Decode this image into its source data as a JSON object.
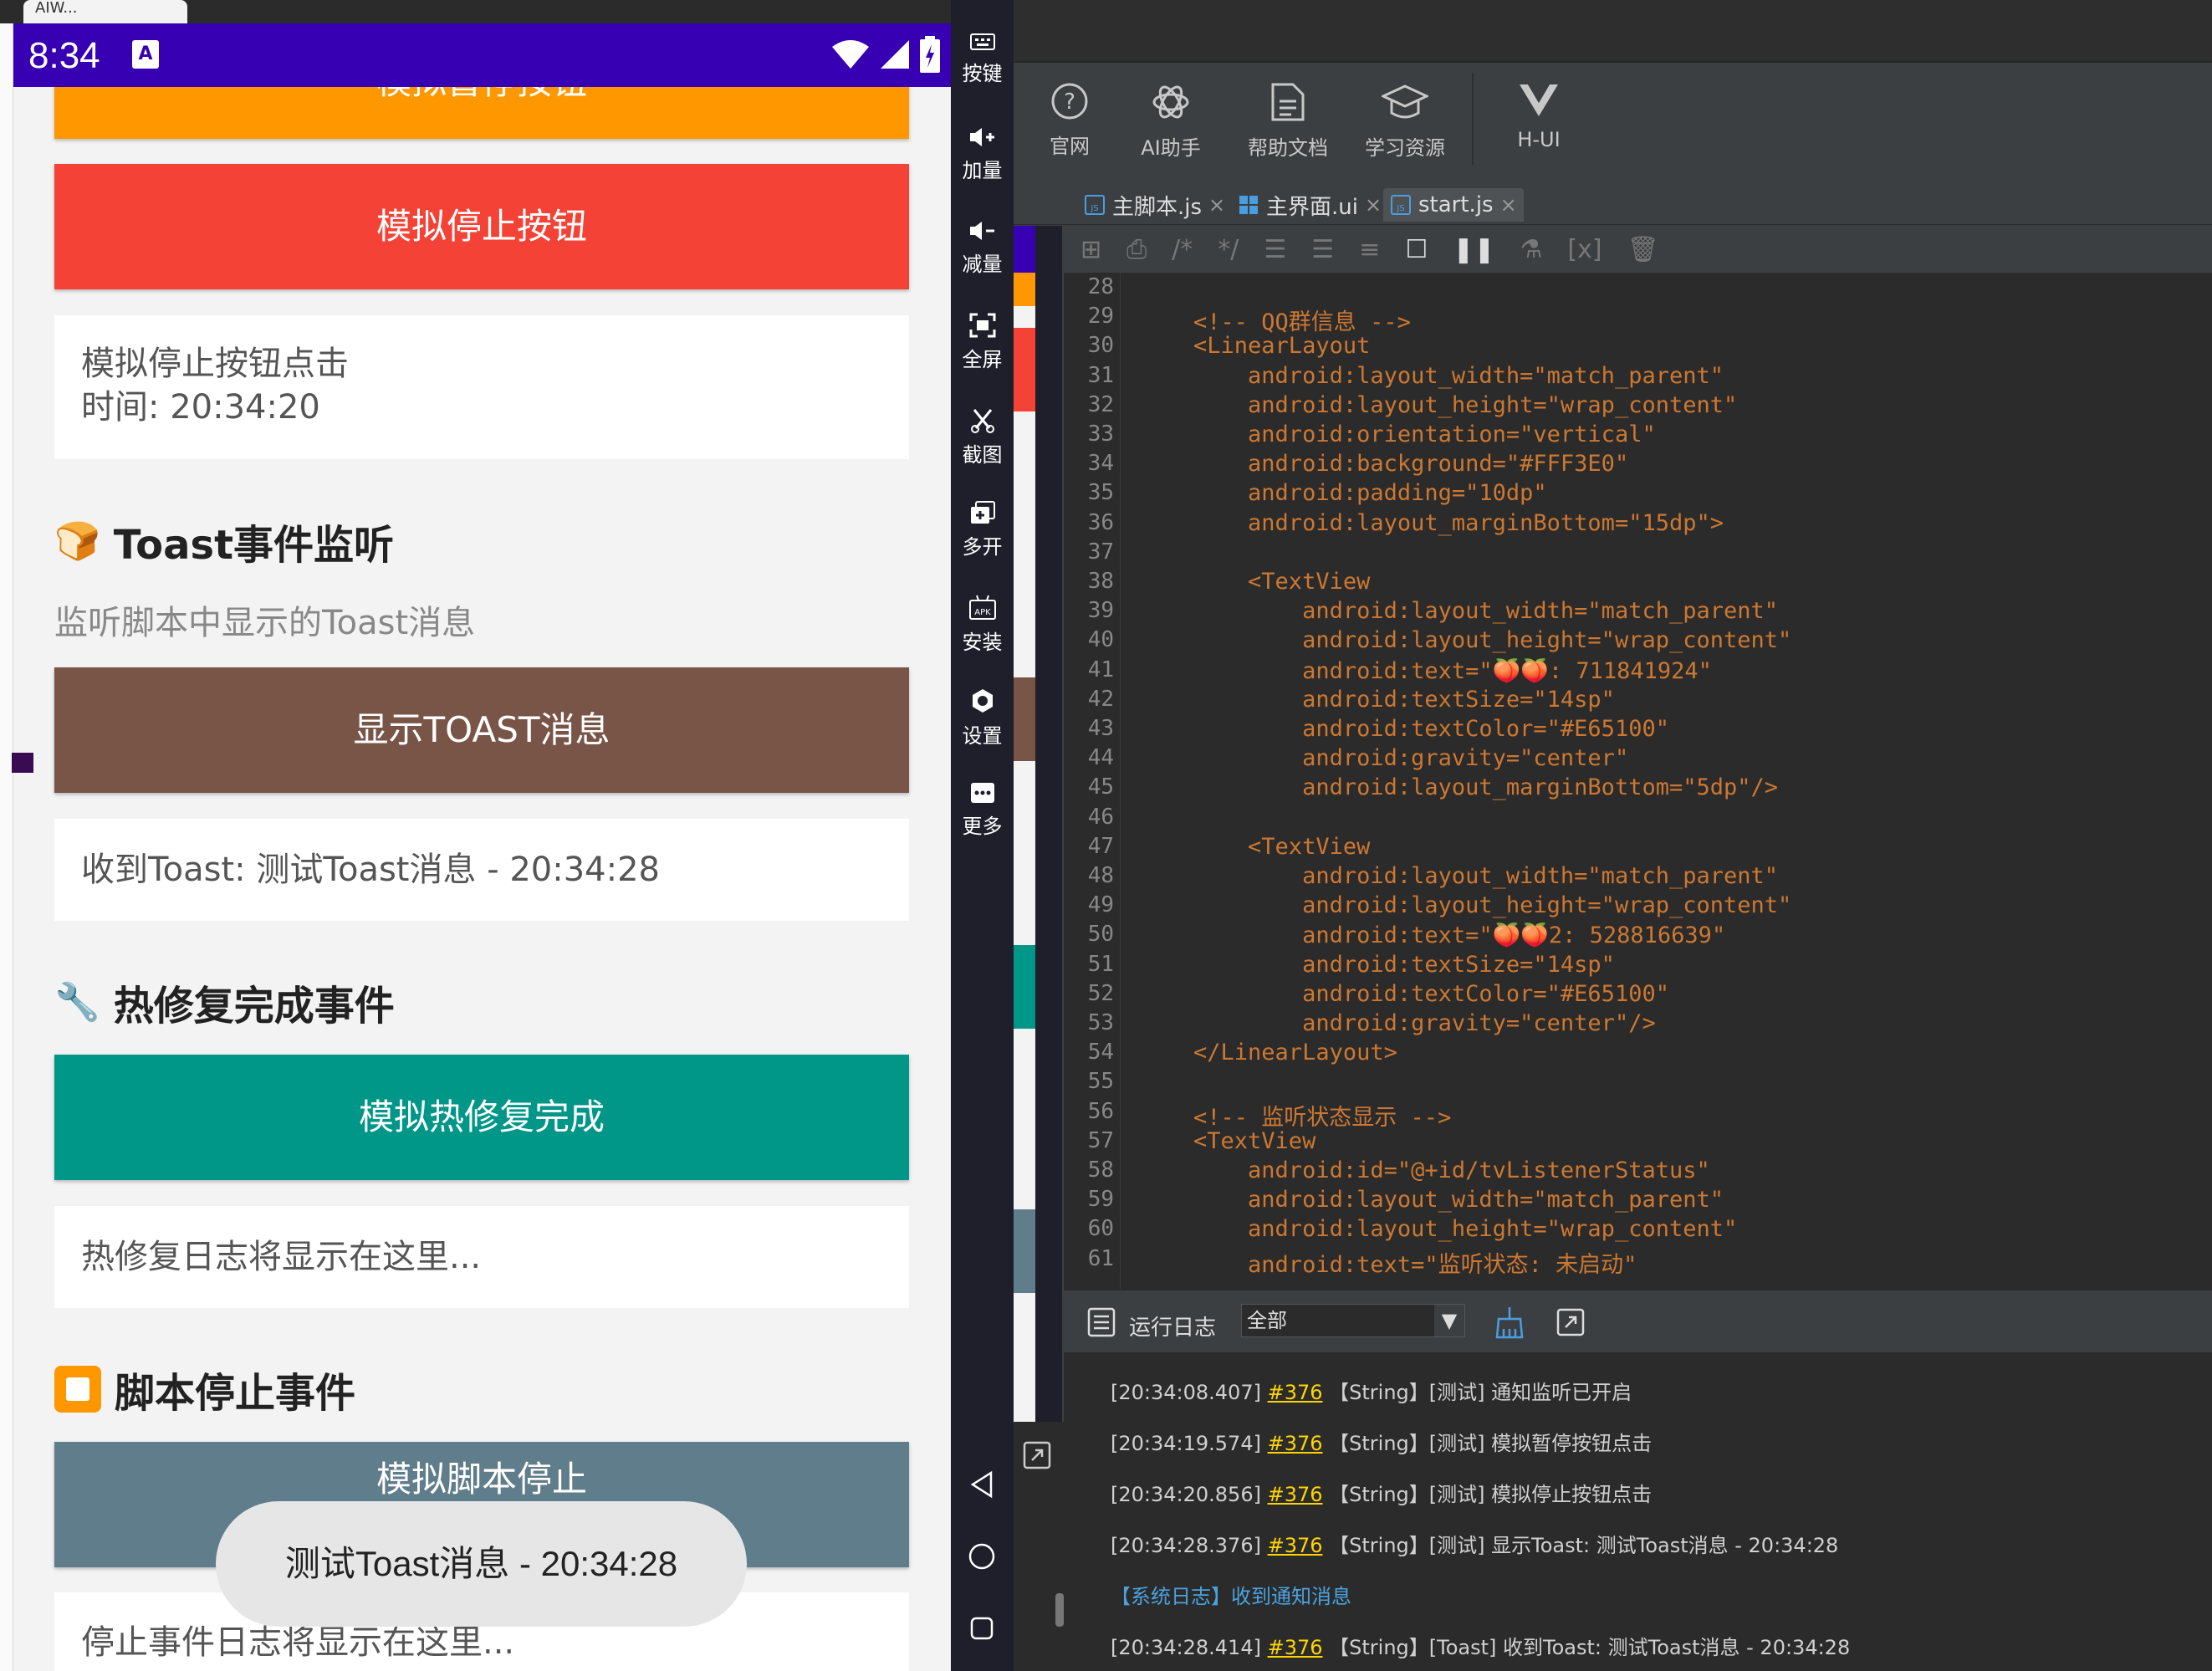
{
  "chrome": {
    "tab_label": "AIW..."
  },
  "status": {
    "time": "8:34",
    "a_icon": "A"
  },
  "phone": {
    "top_partial_button": "模拟暂停按钮",
    "stop_button": "模拟停止按钮",
    "stop_log_line1": "模拟停止按钮点击",
    "stop_log_line2": "时间: 20:34:20",
    "toast_title": "Toast事件监听",
    "toast_emoji": "🍞",
    "toast_sub": "监听脚本中显示的Toast消息",
    "toast_button": "显示TOAST消息",
    "toast_log": "收到Toast: 测试Toast消息 - 20:34:28",
    "hotfix_title": "热修复完成事件",
    "hotfix_emoji": "🔧",
    "hotfix_button": "模拟热修复完成",
    "hotfix_log": "热修复日志将显示在这里...",
    "stopscript_title": "脚本停止事件",
    "stopscript_emoji": "⏹️",
    "stopscript_button": "模拟脚本停止",
    "stopscript_log": "停止事件日志将显示在这里...",
    "toast_popup": "测试Toast消息 - 20:34:28",
    "colors": {
      "orange": "#ff9800",
      "red": "#f44336",
      "brown": "#795548",
      "teal": "#009688",
      "bluegrey": "#607d8b"
    }
  },
  "sidebar": {
    "items": [
      {
        "label": "按键",
        "icon": "keyboard-icon"
      },
      {
        "label": "加量",
        "icon": "volume-up-icon"
      },
      {
        "label": "减量",
        "icon": "volume-down-icon"
      },
      {
        "label": "全屏",
        "icon": "fullscreen-icon"
      },
      {
        "label": "截图",
        "icon": "scissors-icon"
      },
      {
        "label": "多开",
        "icon": "multi-window-icon"
      },
      {
        "label": "安装",
        "icon": "apk-icon"
      },
      {
        "label": "设置",
        "icon": "settings-icon"
      },
      {
        "label": "更多",
        "icon": "more-icon"
      }
    ]
  },
  "ide": {
    "tools": [
      {
        "label": "官网",
        "icon": "help-circle-icon"
      },
      {
        "label": "AI助手",
        "icon": "ai-icon"
      },
      {
        "label": "帮助文档",
        "icon": "document-icon"
      },
      {
        "label": "学习资源",
        "icon": "graduation-cap-icon"
      },
      {
        "label": "H-UI",
        "icon": "vue-icon"
      }
    ],
    "tabs": [
      {
        "label": "主脚本.js"
      },
      {
        "label": "主界面.ui"
      },
      {
        "label": "start.js"
      }
    ],
    "code": [
      {
        "n": "28",
        "t": ""
      },
      {
        "n": "29",
        "t": "    <!-- QQ群信息 -->"
      },
      {
        "n": "30",
        "t": "    <LinearLayout"
      },
      {
        "n": "31",
        "t": "        android:layout_width=\"match_parent\""
      },
      {
        "n": "32",
        "t": "        android:layout_height=\"wrap_content\""
      },
      {
        "n": "33",
        "t": "        android:orientation=\"vertical\""
      },
      {
        "n": "34",
        "t": "        android:background=\"#FFF3E0\""
      },
      {
        "n": "35",
        "t": "        android:padding=\"10dp\""
      },
      {
        "n": "36",
        "t": "        android:layout_marginBottom=\"15dp\">"
      },
      {
        "n": "37",
        "t": ""
      },
      {
        "n": "38",
        "t": "        <TextView"
      },
      {
        "n": "39",
        "t": "            android:layout_width=\"match_parent\""
      },
      {
        "n": "40",
        "t": "            android:layout_height=\"wrap_content\""
      },
      {
        "n": "41",
        "t": "            android:text=\"🍑🍑: 711841924\""
      },
      {
        "n": "42",
        "t": "            android:textSize=\"14sp\""
      },
      {
        "n": "43",
        "t": "            android:textColor=\"#E65100\""
      },
      {
        "n": "44",
        "t": "            android:gravity=\"center\""
      },
      {
        "n": "45",
        "t": "            android:layout_marginBottom=\"5dp\"/>"
      },
      {
        "n": "46",
        "t": ""
      },
      {
        "n": "47",
        "t": "        <TextView"
      },
      {
        "n": "48",
        "t": "            android:layout_width=\"match_parent\""
      },
      {
        "n": "49",
        "t": "            android:layout_height=\"wrap_content\""
      },
      {
        "n": "50",
        "t": "            android:text=\"🍑🍑2: 528816639\""
      },
      {
        "n": "51",
        "t": "            android:textSize=\"14sp\""
      },
      {
        "n": "52",
        "t": "            android:textColor=\"#E65100\""
      },
      {
        "n": "53",
        "t": "            android:gravity=\"center\"/>"
      },
      {
        "n": "54",
        "t": "    </LinearLayout>"
      },
      {
        "n": "55",
        "t": ""
      },
      {
        "n": "56",
        "t": "    <!-- 监听状态显示 -->"
      },
      {
        "n": "57",
        "t": "    <TextView"
      },
      {
        "n": "58",
        "t": "        android:id=\"@+id/tvListenerStatus\""
      },
      {
        "n": "59",
        "t": "        android:layout_width=\"match_parent\""
      },
      {
        "n": "60",
        "t": "        android:layout_height=\"wrap_content\""
      },
      {
        "n": "61",
        "t": "        android:text=\"监听状态: 未启动\""
      }
    ],
    "log": {
      "title": "运行日志",
      "filter": "全部",
      "lines": [
        {
          "ts": "[20:34:08.407]",
          "id": "#376",
          "msg": "【String】[测试] 通知监听已开启"
        },
        {
          "ts": "[20:34:19.574]",
          "id": "#376",
          "msg": "【String】[测试] 模拟暂停按钮点击"
        },
        {
          "ts": "[20:34:20.856]",
          "id": "#376",
          "msg": "【String】[测试] 模拟停止按钮点击"
        },
        {
          "ts": "[20:34:28.376]",
          "id": "#376",
          "msg": "【String】[测试] 显示Toast: 测试Toast消息 - 20:34:28"
        },
        {
          "sys": "【系统日志】收到通知消息"
        },
        {
          "ts": "[20:34:28.414]",
          "id": "#376",
          "msg": "【String】[Toast] 收到Toast: 测试Toast消息 - 20:34:28"
        }
      ]
    }
  }
}
